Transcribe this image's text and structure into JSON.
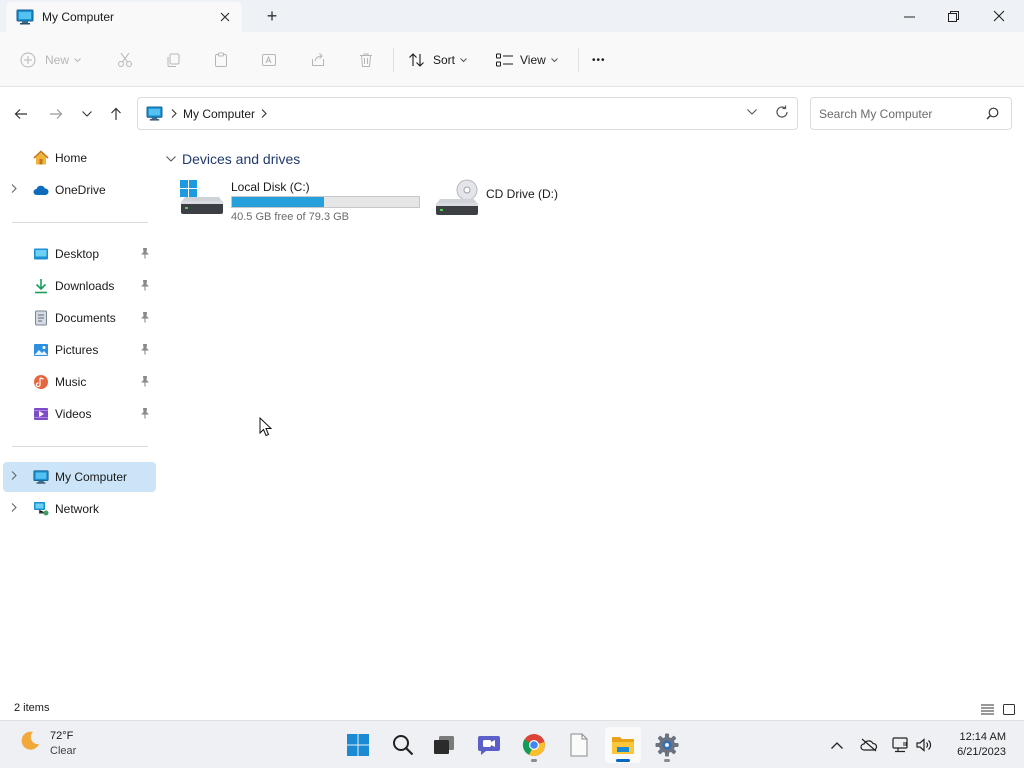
{
  "titlebar": {
    "tab_title": "My Computer",
    "new_tab_symbol": "+"
  },
  "toolbar": {
    "new_label": "New",
    "sort_label": "Sort",
    "view_label": "View",
    "more_symbol": "•••"
  },
  "address": {
    "crumb": "My Computer",
    "search_placeholder": "Search My Computer"
  },
  "nav": {
    "home": "Home",
    "onedrive": "OneDrive",
    "quick_access": [
      {
        "label": "Desktop",
        "icon": "desktop-icon"
      },
      {
        "label": "Downloads",
        "icon": "downloads-icon"
      },
      {
        "label": "Documents",
        "icon": "documents-icon"
      },
      {
        "label": "Pictures",
        "icon": "pictures-icon"
      },
      {
        "label": "Music",
        "icon": "music-icon"
      },
      {
        "label": "Videos",
        "icon": "videos-icon"
      }
    ],
    "my_computer": "My Computer",
    "network": "Network"
  },
  "content": {
    "group_title": "Devices and drives",
    "drives": [
      {
        "name": "Local Disk (C:)",
        "free_text": "40.5 GB free of 79.3 GB",
        "used_fraction": 0.49
      },
      {
        "name": "CD Drive (D:)"
      }
    ]
  },
  "status": {
    "item_count": "2 items"
  },
  "taskbar": {
    "weather_temp": "72°F",
    "weather_cond": "Clear",
    "time": "12:14 AM",
    "date": "6/21/2023"
  },
  "colors": {
    "accent": "#0067c0",
    "drive_fill": "#26a0da",
    "selection": "#cce4f7",
    "group_title": "#1f3a6e"
  }
}
